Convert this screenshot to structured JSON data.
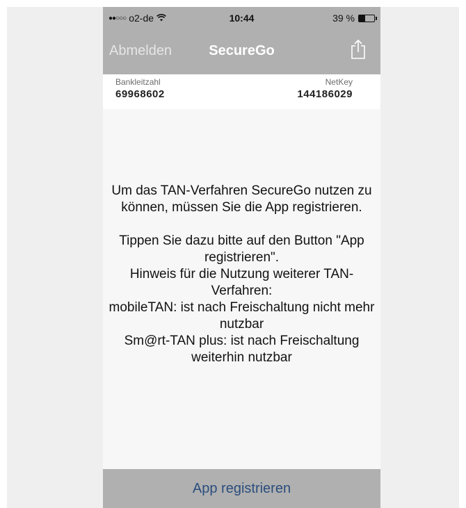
{
  "status_bar": {
    "signal": "●●○○○",
    "carrier": "o2-de",
    "wifi_icon": "wifi-icon",
    "time": "10:44",
    "battery_percent": "39 %",
    "battery_level": 0.39
  },
  "nav": {
    "left_button": "Abmelden",
    "title": "SecureGo",
    "right_icon": "share-icon"
  },
  "account": {
    "blz_label": "Bankleitzahl",
    "blz_value": "69968602",
    "netkey_label": "NetKey",
    "netkey_value": "144186029"
  },
  "message": {
    "p1": "Um das TAN-Verfahren SecureGo nutzen zu können, müssen Sie die App registrieren.",
    "p2": "Tippen Sie dazu bitte auf den Button \"App registrieren\".",
    "p3": "Hinweis für die Nutzung weiterer TAN-Verfahren:",
    "p4": "mobileTAN: ist nach Freischaltung nicht mehr nutzbar",
    "p5": "Sm@rt-TAN plus: ist nach Freischaltung weiterhin nutzbar"
  },
  "bottom_button": "App registrieren",
  "colors": {
    "bar_gray": "#b0b0b0",
    "button_blue": "#2a4d7c"
  }
}
